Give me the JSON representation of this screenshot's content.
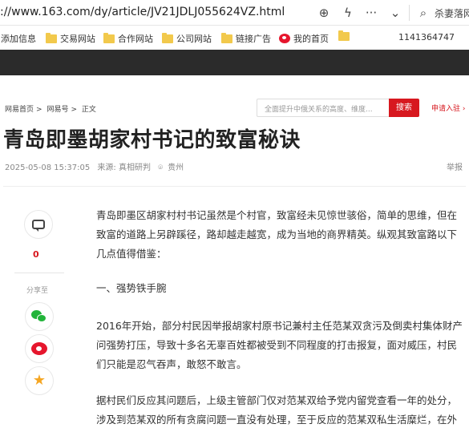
{
  "browser": {
    "url": "://www.163.com/dy/article/JV21JDLJ055624VZ.html",
    "search_preview": "杀妻落网"
  },
  "bookmarks": [
    {
      "label": "添加信息",
      "icon": "none"
    },
    {
      "label": "交易网站",
      "icon": "folder-icon"
    },
    {
      "label": "合作网站",
      "icon": "folder-icon"
    },
    {
      "label": "公司网站",
      "icon": "folder-icon"
    },
    {
      "label": "链接广告",
      "icon": "folder-icon"
    },
    {
      "label": "我的首页",
      "icon": "weibo-icon"
    },
    {
      "label": "",
      "icon": "folder-icon"
    },
    {
      "label": "1141364747",
      "icon": "none"
    }
  ],
  "breadcrumb": [
    "网易首页",
    "网易号",
    "正文"
  ],
  "breadcrumb_sep": ">",
  "search": {
    "placeholder": "全面提升中俄关系的高度、维度...",
    "button": "搜索"
  },
  "apply_link": "申请入驻",
  "article": {
    "title": "青岛即墨胡家村书记的致富秘诀",
    "datetime": "2025-05-08 15:37:05",
    "source": "来源: 真相研判",
    "location": "贵州",
    "report": "举报",
    "paragraphs": [
      "青岛即墨区胡家村村书记虽然是个村官，致富经未见惊世骇俗，简单的思维，但在致富的道路上另辟蹊径，路却越走越宽，成为当地的商界精英。纵观其致富路以下几点值得借鉴：",
      "一、强势铁手腕",
      "2016年开始，部分村民因举报胡家村原书记兼村主任范某双贪污及倒卖村集体财产问强势打压，导致十多名无辜百姓都被受到不同程度的打击报复，面对威压，村民们只能是忍气吞声，敢怒不敢言。",
      "据村民们反应其问题后，上级主管部门仅对范某双给予党内留党查看一年的处分，涉及到范某双的所有贪腐问题一直没有处理，至于反应的范某双私生活糜烂，在外购买"
    ]
  },
  "sidebar": {
    "comment_count": "0",
    "share_label": "分享至"
  },
  "colors": {
    "accent": "#d7181f",
    "header": "#2b2b2b"
  }
}
